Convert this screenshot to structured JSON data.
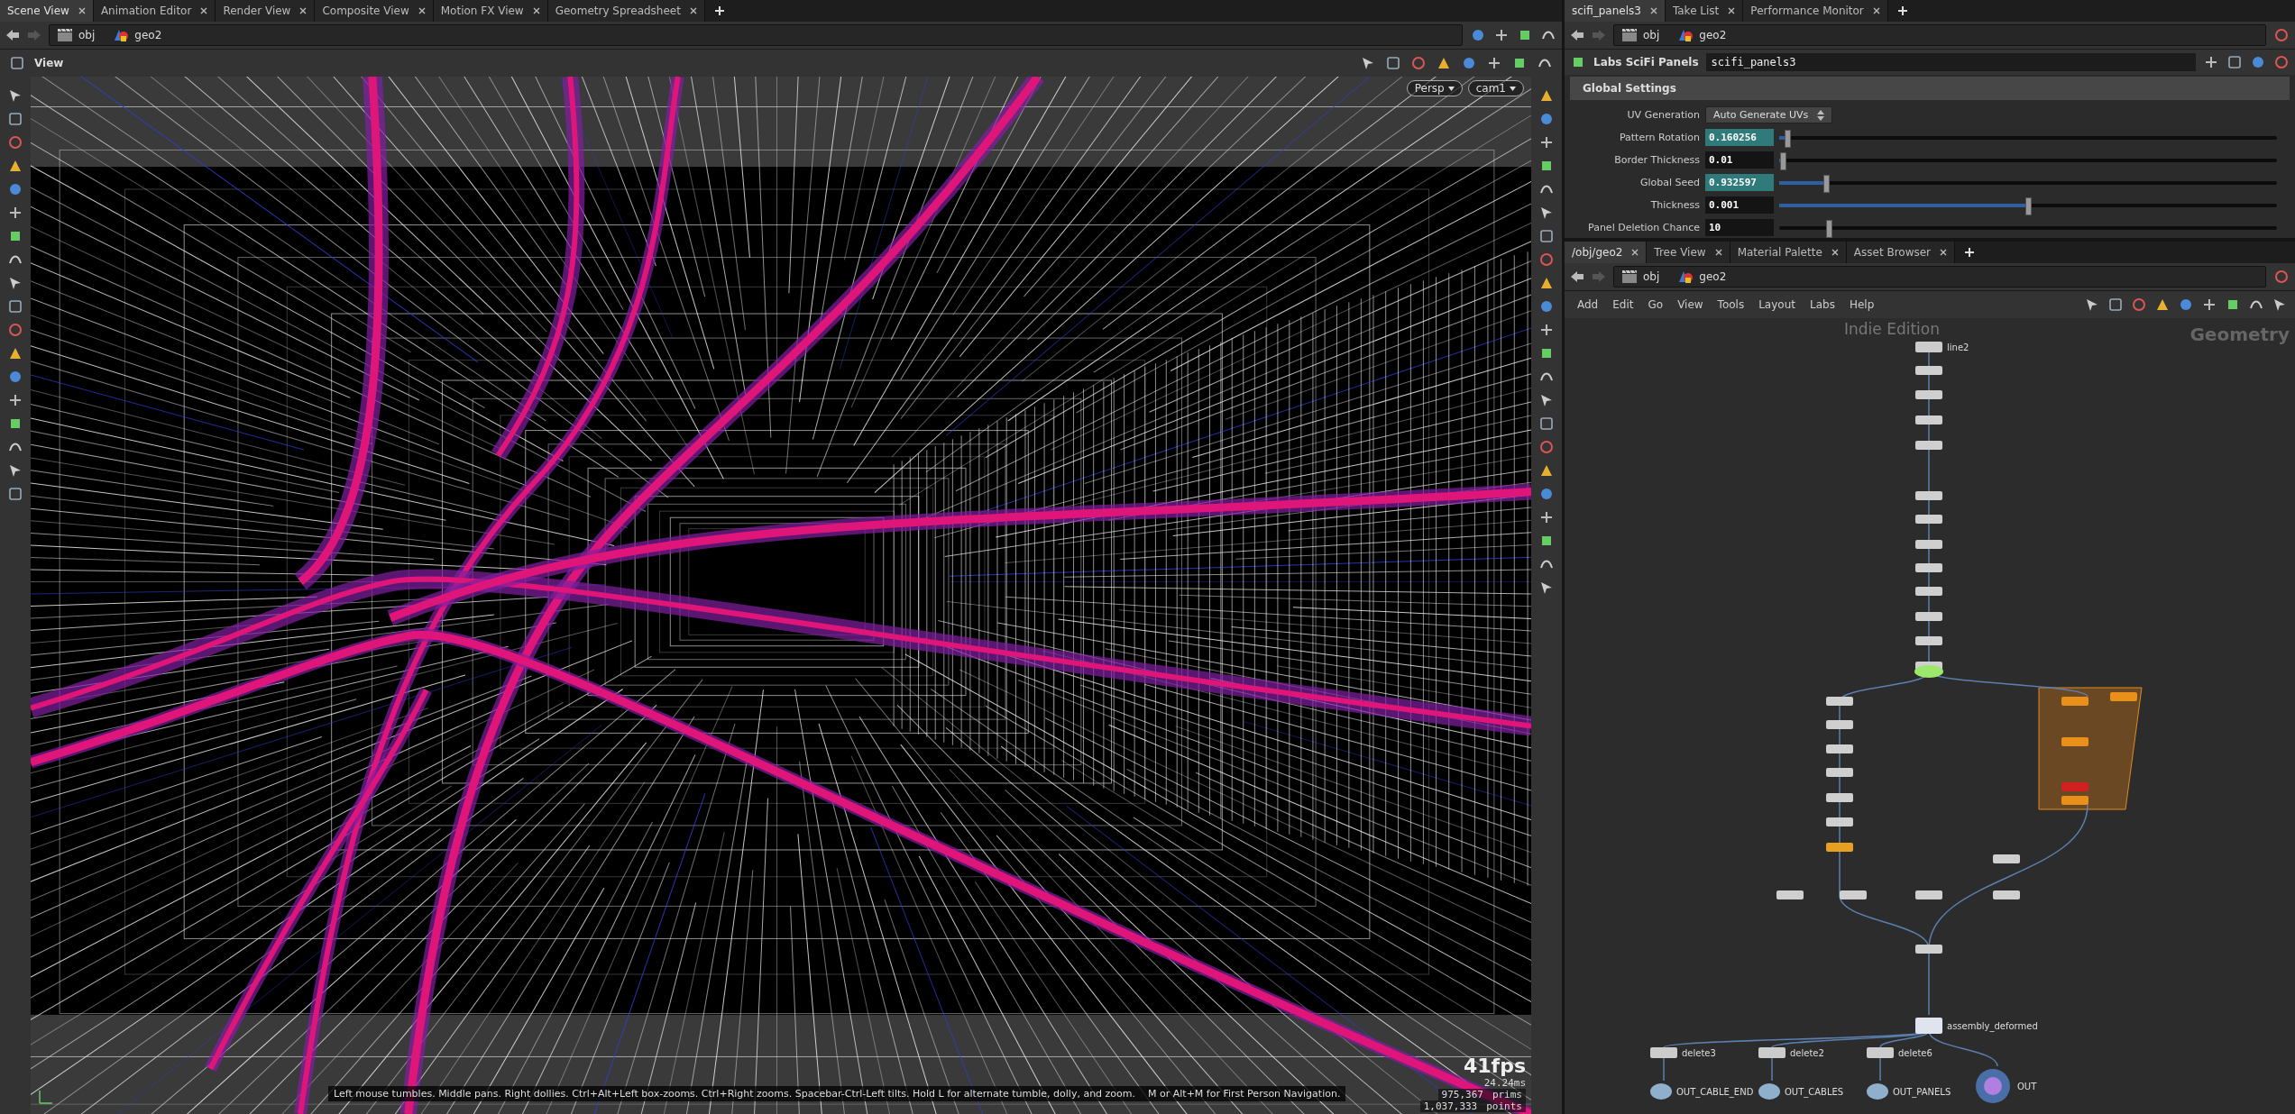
{
  "scene_pane": {
    "tabs": [
      {
        "label": "Scene View",
        "selected": true
      },
      {
        "label": "Animation Editor",
        "selected": false
      },
      {
        "label": "Render View",
        "selected": false
      },
      {
        "label": "Composite View",
        "selected": false
      },
      {
        "label": "Motion FX View",
        "selected": false
      },
      {
        "label": "Geometry Spreadsheet",
        "selected": false
      }
    ],
    "path": [
      {
        "label": "obj",
        "kind": "context"
      },
      {
        "label": "geo2",
        "kind": "object"
      }
    ],
    "view_label": "View",
    "camera_menus": [
      "Persp",
      "cam1"
    ],
    "hint": "Left mouse tumbles. Middle pans. Right dollies. Ctrl+Alt+Left box-zooms. Ctrl+Right zooms. Spacebar-Ctrl-Left tilts. Hold L for alternate tumble, dolly, and zoom.    M or Alt+M for First Person Navigation.",
    "stats": {
      "fps": "41fps",
      "frame_time": "24.24ms",
      "prims": "975,367",
      "prims_label": "prims",
      "points": "1,037,333",
      "points_label": "points"
    }
  },
  "parameter_pane": {
    "tabs": [
      {
        "label": "scifi_panels3",
        "selected": true
      },
      {
        "label": "Take List",
        "selected": false
      },
      {
        "label": "Performance Monitor",
        "selected": false
      }
    ],
    "path": [
      {
        "label": "obj",
        "kind": "context"
      },
      {
        "label": "geo2",
        "kind": "object"
      }
    ],
    "node_type": "Labs SciFi Panels",
    "node_name": "scifi_panels3",
    "folder": "Global Settings",
    "params": [
      {
        "label": "UV Generation",
        "kind": "menu",
        "value": "Auto Generate UVs"
      },
      {
        "label": "Pattern Rotation",
        "kind": "float",
        "value": "0.160256",
        "keyed": true,
        "level": 0.016
      },
      {
        "label": "Border Thickness",
        "kind": "float",
        "value": "0.01",
        "keyed": false,
        "level": 0.008
      },
      {
        "label": "Global Seed",
        "kind": "float",
        "value": "0.932597",
        "keyed": true,
        "level": 0.094
      },
      {
        "label": "Thickness",
        "kind": "float",
        "value": "0.001",
        "keyed": false,
        "level": 0.5
      },
      {
        "label": "Panel Deletion Chance",
        "kind": "int",
        "value": "10",
        "keyed": false,
        "level": 0.1
      }
    ]
  },
  "network_pane": {
    "tabs": [
      {
        "label": "/obj/geo2",
        "selected": true
      },
      {
        "label": "Tree View",
        "selected": false
      },
      {
        "label": "Material Palette",
        "selected": false
      },
      {
        "label": "Asset Browser",
        "selected": false
      }
    ],
    "path": [
      {
        "label": "obj",
        "kind": "context"
      },
      {
        "label": "geo2",
        "kind": "object"
      }
    ],
    "menu": [
      "Add",
      "Edit",
      "Go",
      "View",
      "Tools",
      "Layout",
      "Labs",
      "Help"
    ],
    "edition_label": "Indie Edition",
    "context_label": "Geometry",
    "nodes": [
      {
        "label": "line2",
        "kind": "sop"
      },
      {
        "label": "assembly_deformed",
        "kind": "cache"
      },
      {
        "label": "delete3",
        "kind": "sop"
      },
      {
        "label": "delete2",
        "kind": "sop"
      },
      {
        "label": "delete6",
        "kind": "sop"
      },
      {
        "label": "OUT_CABLE_END",
        "kind": "null"
      },
      {
        "label": "OUT_CABLES",
        "kind": "null"
      },
      {
        "label": "OUT_PANELS",
        "kind": "null"
      },
      {
        "label": "OUT",
        "kind": "output"
      }
    ]
  }
}
